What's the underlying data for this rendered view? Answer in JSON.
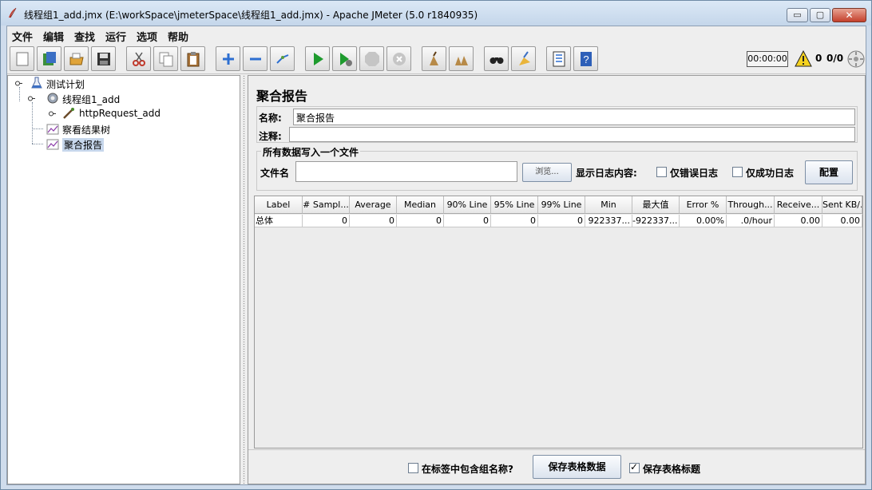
{
  "window": {
    "title": "线程组1_add.jmx (E:\\workSpace\\jmeterSpace\\线程组1_add.jmx) - Apache JMeter (5.0 r1840935)",
    "min_glyph": "▭",
    "max_glyph": "▢",
    "close_glyph": "✕"
  },
  "menu": [
    "文件",
    "编辑",
    "查找",
    "运行",
    "选项",
    "帮助"
  ],
  "toolbar": {
    "timer": "00:00:00",
    "warning_count": "0",
    "thread_count": "0/0",
    "buttons": [
      "new-icon",
      "templates-icon",
      "open-icon",
      "save-icon",
      "cut-icon",
      "copy-icon",
      "paste-icon",
      "expand-icon",
      "collapse-icon",
      "toggle-icon",
      "start-icon",
      "start-no-pause-icon",
      "stop-icon",
      "shutdown-icon",
      "clear-icon",
      "clear-all-icon",
      "search-icon",
      "reset-search-icon",
      "function-helper-icon",
      "help-icon"
    ]
  },
  "tree": {
    "nodes": [
      {
        "label": "测试计划",
        "icon": "test-plan-icon"
      },
      {
        "label": "线程组1_add",
        "icon": "thread-group-icon"
      },
      {
        "label": "httpRequest_add",
        "icon": "sampler-icon"
      },
      {
        "label": "察看结果树",
        "icon": "listener-icon"
      },
      {
        "label": "聚合报告",
        "icon": "listener-icon",
        "selected": true
      }
    ]
  },
  "panel": {
    "title": "聚合报告",
    "name_label": "名称:",
    "name_value": "聚合报告",
    "comment_label": "注释:",
    "comment_value": "",
    "file_group_title": "所有数据写入一个文件",
    "filename_label": "文件名",
    "filename_value": "",
    "browse_label": "浏览...",
    "log_label": "显示日志内容:",
    "errors_only_label": "仅错误日志",
    "errors_only_checked": false,
    "success_only_label": "仅成功日志",
    "success_only_checked": false,
    "configure_label": "配置"
  },
  "table": {
    "headers": [
      "Label",
      "# Sampl...",
      "Average",
      "Median",
      "90% Line",
      "95% Line",
      "99% Line",
      "Min",
      "最大值",
      "Error %",
      "Through...",
      "Receive...",
      "Sent KB/..."
    ],
    "rows": [
      [
        "总体",
        "0",
        "0",
        "0",
        "0",
        "0",
        "0",
        "922337...",
        "-922337...",
        "0.00%",
        ".0/hour",
        "0.00",
        "0.00"
      ]
    ]
  },
  "bottom": {
    "include_group_label": "在标签中包含组名称?",
    "include_group_checked": false,
    "save_table_label": "保存表格数据",
    "save_header_label": "保存表格标题",
    "save_header_checked": true
  }
}
